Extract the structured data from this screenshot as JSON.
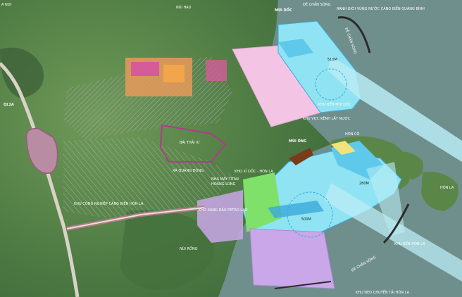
{
  "map": {
    "labels": {
      "corner": "A NOI",
      "ql1a": "QL1A",
      "nui_hau": "NÚI HAU",
      "mui_doc": "MŨI DỐC",
      "de_chan_song_top": "ĐÊ CHẮN SÓNG",
      "ranh_gioi": "RANH GIỚI VÙNG NƯỚC CẢNG BIỂN QUẢNG BÌNH",
      "de_chan_song_right": "ĐÊ CHẮN SÓNG",
      "dist_510m": "510M",
      "khu_ben_mui_doc": "KHU BẾN MŨI DỐC",
      "khu_vuc_kenh": "KHU VỰC KÊNH LẤY NƯỚC",
      "hon_co": "HÒN CÓ",
      "mui_ong": "MŨI ÔNG",
      "bai_thai": "BÃI THẢI XỈ",
      "xa_quang_dong": "XÃ QUẢNG ĐÔNG",
      "kho_xi_doc": "KHO XỈ DỐC - HÒN LA",
      "nha_may_titan": "NHÀ MÁY TITAN",
      "hoang_long": "HOÀNG LONG",
      "khu_cong_nghiep": "KHU CÔNG NGHIỆP CẢNG BIỂN HÒN LA",
      "kho_xang_dau": "KHO XĂNG DẦU PETRO LAO",
      "dist_500m": "500M",
      "dist_280m": "280M",
      "hon_la": "HÒN LA",
      "khu_ben_hon_la": "KHU BẾN HÒN LA",
      "nui_rong": "NÚI RỒNG",
      "de_chan_song_bottom": "ĐÊ CHẮN SÓNG",
      "khu_neo": "KHU NEO CHUYỂN TẢI HÒN LA"
    },
    "colors": {
      "sea": "#6f8f8c",
      "land": "#5d8a4a",
      "port_basin": "#8fe3f2",
      "channel": "#b9ecf5",
      "pink_zone": "#f4c4e4",
      "green_zone": "#7fe06a",
      "violet_zone": "#c9a7e8",
      "yellow_zone": "#f2e27a",
      "road": "#d9d2c8"
    }
  }
}
